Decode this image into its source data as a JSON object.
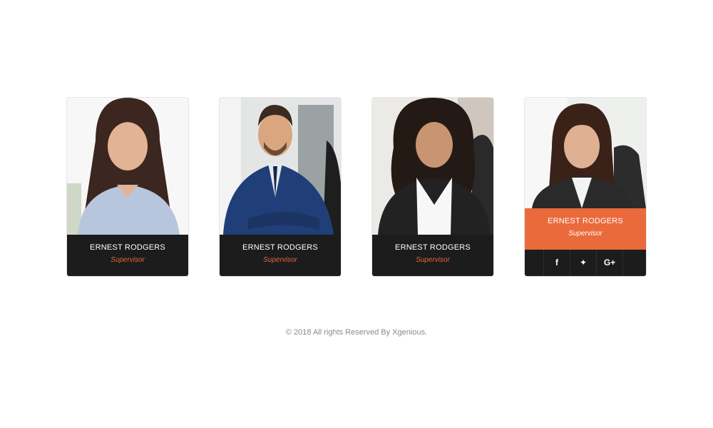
{
  "team": [
    {
      "name": "ERNEST RODGERS",
      "role": "Supervisor"
    },
    {
      "name": "ERNEST RODGERS",
      "role": "Supervisor"
    },
    {
      "name": "ERNEST RODGERS",
      "role": "Supervisor"
    },
    {
      "name": "ERNEST RODGERS",
      "role": "Supervisor",
      "highlighted": true
    }
  ],
  "social": {
    "facebook_icon": "f",
    "twitter_icon": "✦",
    "google_plus_icon": "G+"
  },
  "footer": {
    "copyright": "© 2018 All rights Reserved By Xgenious."
  },
  "colors": {
    "accent": "#ea6a3b",
    "caption_bg": "#1c1c1c",
    "role_text": "#e8643a"
  }
}
